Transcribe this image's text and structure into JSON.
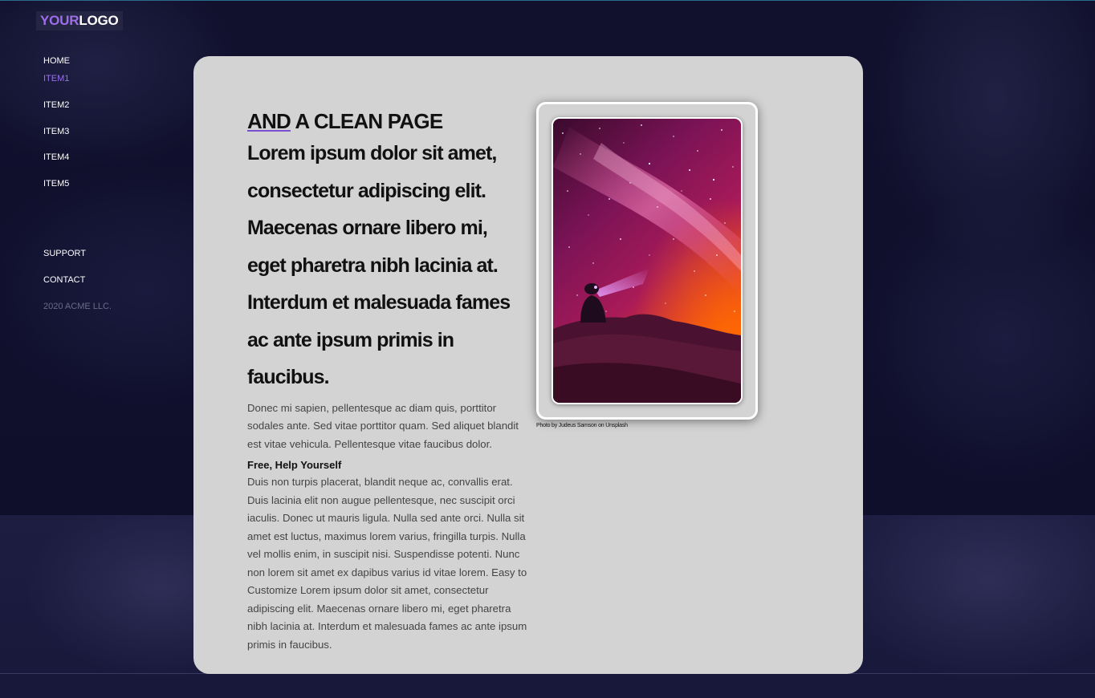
{
  "logo": {
    "part1": "YOUR",
    "part2": "LOGO"
  },
  "nav": {
    "items": [
      "HOME",
      "ITEM1",
      "ITEM2",
      "ITEM3",
      "ITEM4",
      "ITEM5"
    ],
    "active": "ITEM1",
    "footer_links": [
      "SUPPORT",
      "CONTACT"
    ],
    "copyright": "2020 ACME LLC."
  },
  "content": {
    "kicker_underlined": "AND",
    "kicker_rest": " A CLEAN PAGE",
    "headline": "Lorem ipsum dolor sit amet, consectetur adipiscing elit. Maecenas ornare libero mi, eget pharetra nibh lacinia at. Interdum et malesuada fames ac ante ipsum primis in faucibus.",
    "paragraph1": "Donec mi sapien, pellentesque ac diam quis, porttitor sodales ante. Sed vitae porttitor quam. Sed aliquet blandit est vitae vehicula. Pellentesque vitae faucibus dolor.",
    "subheading": "Free, Help Yourself",
    "paragraph2": "Duis non turpis placerat, blandit neque ac, convallis erat. Duis lacinia elit non augue pellentesque, nec suscipit orci iaculis. Donec ut mauris ligula. Nulla sed ante orci. Nulla sit amet est luctus, maximus lorem varius, fringilla turpis. Nulla vel mollis enim, in suscipit nisi. Suspendisse potenti. Nunc non lorem sit amet ex dapibus varius id vitae lorem. Easy to Customize Lorem ipsum dolor sit amet, consectetur adipiscing elit. Maecenas ornare libero mi, eget pharetra nibh lacinia at. Interdum et malesuada fames ac ante ipsum primis in faucibus."
  },
  "photo": {
    "caption": "Photo by Judeus Samson on Unsplash"
  },
  "colors": {
    "accent": "#9a70f0",
    "page_background": "#0c0c2a",
    "card_background": "#d3d3d3"
  }
}
